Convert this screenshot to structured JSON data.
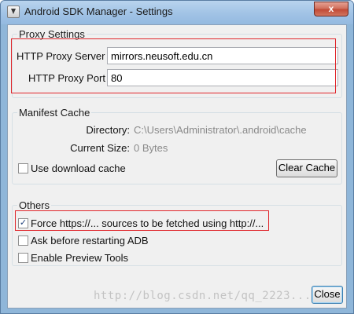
{
  "window": {
    "title": "Android SDK Manager - Settings",
    "close_symbol": "x"
  },
  "proxy": {
    "legend": "Proxy Settings",
    "server_label": "HTTP Proxy Server",
    "server_value": "mirrors.neusoft.edu.cn",
    "port_label": "HTTP Proxy Port",
    "port_value": "80"
  },
  "manifest": {
    "legend": "Manifest Cache",
    "directory_label": "Directory:",
    "directory_value": "C:\\Users\\Administrator\\.android\\cache",
    "size_label": "Current Size:",
    "size_value": "0 Bytes",
    "use_download_cache_label": "Use download cache",
    "use_download_cache_checked": false,
    "clear_cache_label": "Clear Cache"
  },
  "others": {
    "legend": "Others",
    "force_http_label": "Force https://... sources to be fetched using http://...",
    "force_http_checked": true,
    "ask_restart_label": "Ask before restarting ADB",
    "ask_restart_checked": false,
    "preview_tools_label": "Enable Preview Tools",
    "preview_tools_checked": false
  },
  "footer": {
    "close_button_label": "Close"
  },
  "watermark": "http://blog.csdn.net/qq_2223...",
  "colors": {
    "highlight_red": "#e0262b",
    "titlebar_blue": "#a3c4e6",
    "dialog_bg": "#f0f0f0"
  }
}
